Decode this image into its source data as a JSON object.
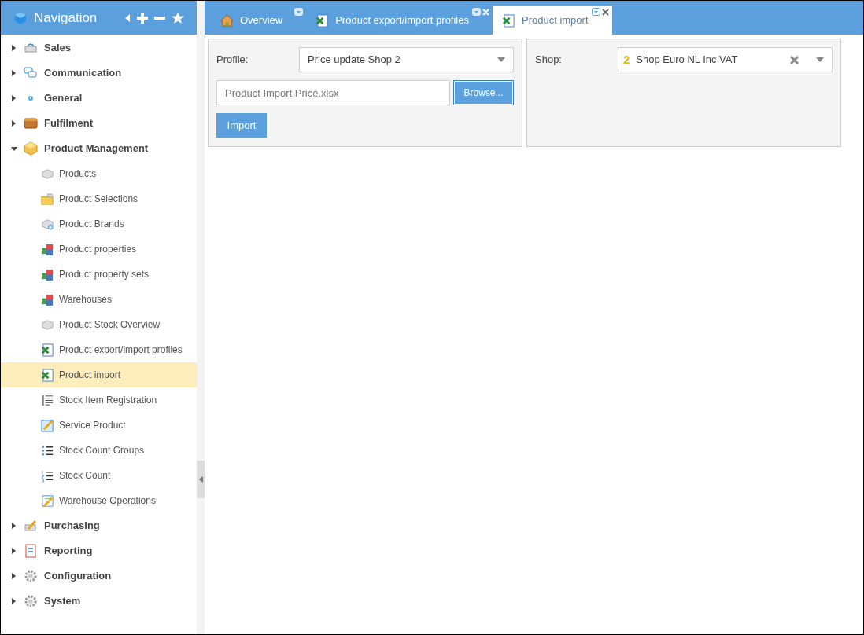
{
  "navigation": {
    "title": "Navigation",
    "groups": [
      {
        "label": "Sales",
        "expanded": false
      },
      {
        "label": "Communication",
        "expanded": false
      },
      {
        "label": "General",
        "expanded": false
      },
      {
        "label": "Fulfilment",
        "expanded": false
      },
      {
        "label": "Product Management",
        "expanded": true,
        "children": [
          {
            "label": "Products",
            "selected": false
          },
          {
            "label": "Product Selections",
            "selected": false
          },
          {
            "label": "Product Brands",
            "selected": false
          },
          {
            "label": "Product properties",
            "selected": false
          },
          {
            "label": "Product property sets",
            "selected": false
          },
          {
            "label": "Warehouses",
            "selected": false
          },
          {
            "label": "Product Stock Overview",
            "selected": false
          },
          {
            "label": "Product export/import profiles",
            "selected": false
          },
          {
            "label": "Product import",
            "selected": true
          },
          {
            "label": "Stock Item Registration",
            "selected": false
          },
          {
            "label": "Service Product",
            "selected": false
          },
          {
            "label": "Stock Count Groups",
            "selected": false
          },
          {
            "label": "Stock Count",
            "selected": false
          },
          {
            "label": "Warehouse Operations",
            "selected": false
          }
        ]
      },
      {
        "label": "Purchasing",
        "expanded": false
      },
      {
        "label": "Reporting",
        "expanded": false
      },
      {
        "label": "Configuration",
        "expanded": false
      },
      {
        "label": "System",
        "expanded": false
      }
    ]
  },
  "tabs": [
    {
      "label": "Overview",
      "selected": false,
      "closable": false
    },
    {
      "label": "Product export/import profiles",
      "selected": false,
      "closable": true
    },
    {
      "label": "Product import",
      "selected": true,
      "closable": true
    }
  ],
  "import_panel": {
    "profile_label": "Profile:",
    "profile_value": "Price update Shop 2",
    "file_value": "Product Import Price.xlsx",
    "browse_button": "Browse...",
    "import_button": "Import"
  },
  "shop_panel": {
    "shop_label": "Shop:",
    "shop_badge": "2",
    "shop_value": "Shop Euro NL Inc VAT"
  }
}
